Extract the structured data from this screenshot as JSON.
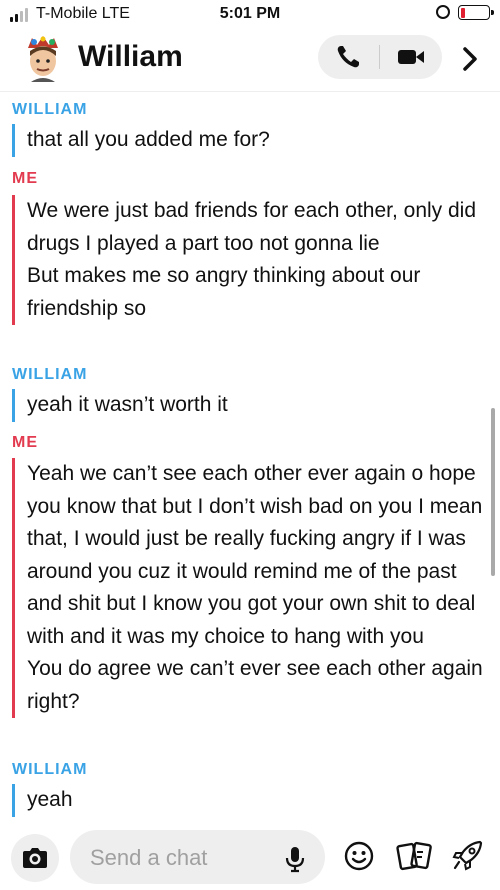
{
  "status_bar": {
    "carrier": "T-Mobile  LTE",
    "time": "5:01 PM"
  },
  "header": {
    "contact_name": "William",
    "icons": [
      "avatar",
      "phone-icon",
      "video-icon",
      "chevron-right-icon"
    ]
  },
  "messages": [
    {
      "sender": "WILLIAM",
      "text": "that all you added me for?"
    },
    {
      "sender": "ME",
      "text": "We were just bad friends for each other, only did drugs I played a part too not gonna lie\nBut makes me so angry thinking about our friendship so"
    },
    {
      "sender": "WILLIAM",
      "text": "yeah it wasn’t worth it"
    },
    {
      "sender": "ME",
      "text": "Yeah we can’t see each other ever again o hope you know that but I don’t wish bad on you I mean that, I would just be really fucking angry if I was around you cuz it would remind me of the past and shit but I know you got your own shit to deal with and it was my choice to hang with you\nYou do agree we can’t ever see each other again right?"
    },
    {
      "sender": "WILLIAM",
      "text": "yeah"
    }
  ],
  "composer": {
    "placeholder": "Send a chat",
    "icons": [
      "camera-icon",
      "mic-icon",
      "smile-icon",
      "cards-icon",
      "rocket-icon"
    ]
  },
  "colors": {
    "william": "#3aa3e6",
    "me": "#e23b4f"
  }
}
